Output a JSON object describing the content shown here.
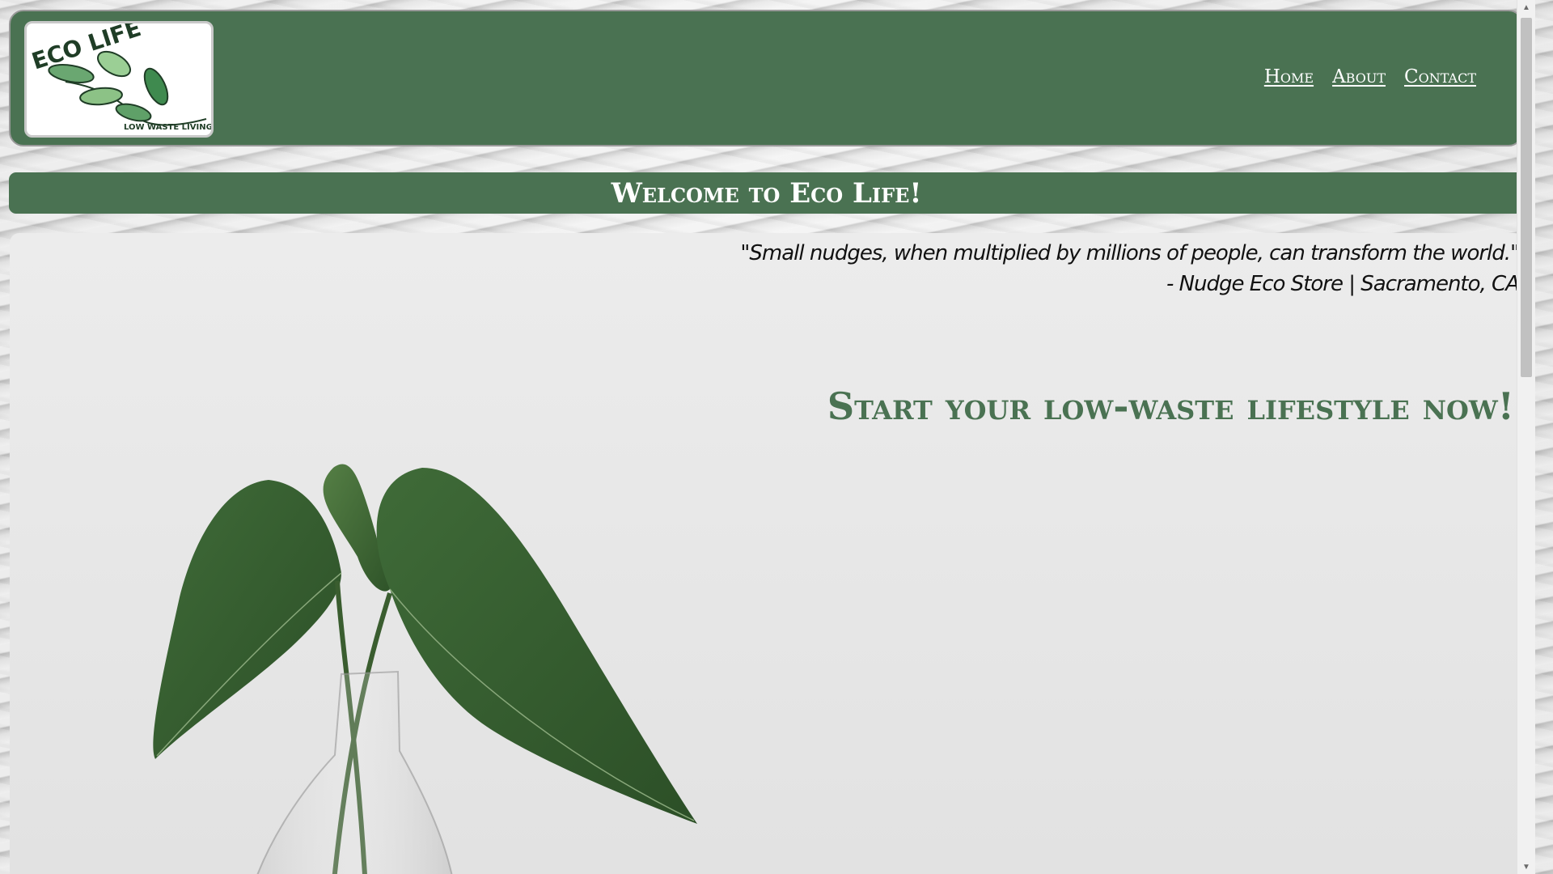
{
  "header": {
    "logo": {
      "title": "ECO LIFE",
      "tagline": "LOW WASTE LIVING"
    },
    "nav": [
      {
        "label": "Home"
      },
      {
        "label": "About"
      },
      {
        "label": "Contact"
      }
    ]
  },
  "banner": {
    "title": "Welcome to Eco Life!"
  },
  "hero": {
    "quote_line1": "\"Small nudges, when multiplied by millions of people, can transform the world.\"",
    "quote_line2": "- Nudge Eco Store | Sacramento, CA",
    "cta": "Start your low-waste lifestyle now!"
  },
  "colors": {
    "brand_green": "#4a7252",
    "nav_text": "#ffffff",
    "hero_bg": "#e9e9e9"
  }
}
